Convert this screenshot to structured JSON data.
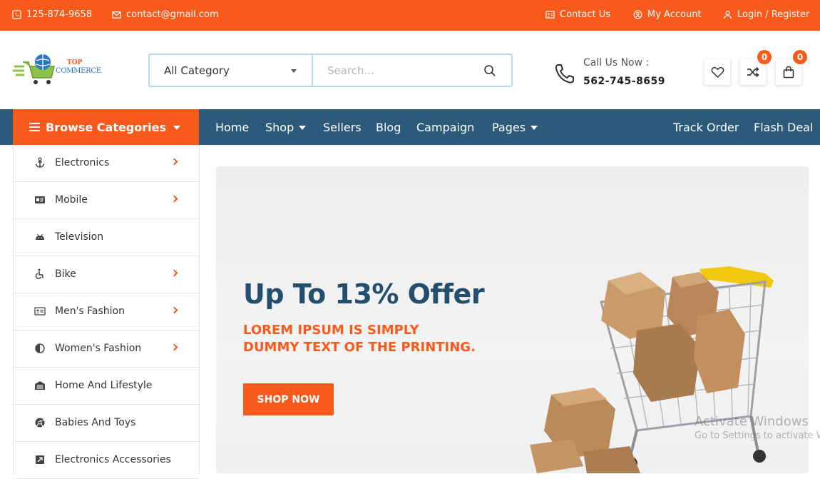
{
  "topbar": {
    "phone": "125-874-9658",
    "email": "contact@gmail.com",
    "contact_us": "Contact Us",
    "my_account": "My Account",
    "login_register": "Login / Register"
  },
  "header": {
    "logo_top": "TOP",
    "logo_main": "COMMERCE",
    "category_select": "All Category",
    "search_placeholder": "Search...",
    "call_label": "Call Us Now :",
    "call_number": "562-745-8659",
    "compare_count": "0",
    "cart_count": "0"
  },
  "nav": {
    "browse": "Browse Categories",
    "items": [
      {
        "label": "Home"
      },
      {
        "label": "Shop"
      },
      {
        "label": "Sellers"
      },
      {
        "label": "Blog"
      },
      {
        "label": "Campaign"
      },
      {
        "label": "Pages"
      },
      {
        "label": "Track Order"
      },
      {
        "label": "Flash Deal"
      }
    ]
  },
  "sidebar": {
    "items": [
      {
        "label": "Electronics",
        "icon": "anchor-icon"
      },
      {
        "label": "Mobile",
        "icon": "id-card-icon"
      },
      {
        "label": "Television",
        "icon": "android-icon"
      },
      {
        "label": "Bike",
        "icon": "accessibility-icon"
      },
      {
        "label": "Men's Fashion",
        "icon": "address-card-icon"
      },
      {
        "label": "Women's Fashion",
        "icon": "half-circle-icon"
      },
      {
        "label": "Home And Lifestyle",
        "icon": "archive-icon"
      },
      {
        "label": "Babies And Toys",
        "icon": "chrome-icon"
      },
      {
        "label": "Electronics Accessories",
        "icon": "square-icon"
      }
    ]
  },
  "banner": {
    "title": "Up To 13% Offer",
    "subtitle_line1": "LOREM IPSUM IS SIMPLY",
    "subtitle_line2": "DUMMY TEXT OF THE PRINTING.",
    "button": "SHOP NOW"
  },
  "watermark": {
    "line1": "Activate Windows",
    "line2": "Go to Settings to activate Windows."
  },
  "colors": {
    "accent": "#f85a1c",
    "navy": "#2b5a7b",
    "title": "#234e6e"
  }
}
